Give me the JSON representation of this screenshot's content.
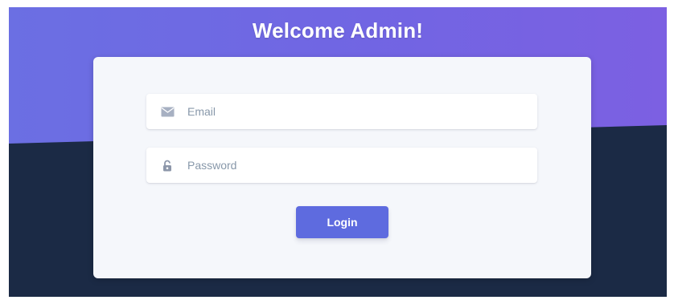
{
  "page": {
    "title": "Welcome Admin!"
  },
  "login_form": {
    "email": {
      "placeholder": "Email",
      "value": "",
      "icon": "envelope-icon"
    },
    "password": {
      "placeholder": "Password",
      "value": "",
      "icon": "lock-icon"
    },
    "submit_label": "Login"
  },
  "colors": {
    "header_gradient_start": "#6b6fe3",
    "header_gradient_end": "#7c60e2",
    "background_dark": "#1b2a45",
    "card_background": "#f5f7fb",
    "button_primary": "#5e6bdf",
    "icon_color": "#9aa4b8"
  }
}
